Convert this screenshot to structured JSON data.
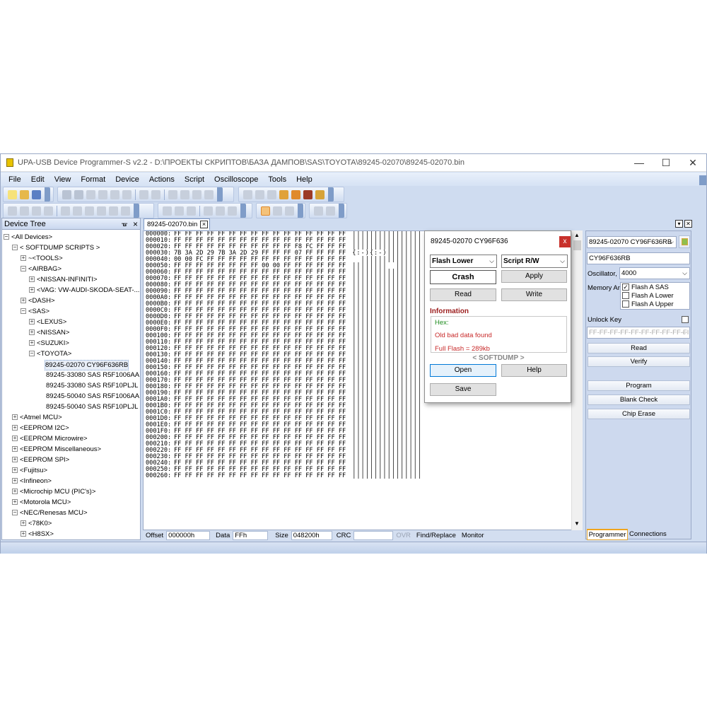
{
  "window": {
    "title": "UPA-USB Device Programmer-S v2.2 - D:\\ПРОЕКТЫ СКРИПТОВ\\БАЗА ДАМПОВ\\SAS\\TOYOTA\\89245-02070\\89245-02070.bin",
    "minimize": "—",
    "maximize": "☐",
    "close": "✕"
  },
  "menu": [
    "File",
    "Edit",
    "View",
    "Format",
    "Device",
    "Actions",
    "Script",
    "Oscilloscope",
    "Tools",
    "Help"
  ],
  "device_tree": {
    "title": "Device Tree",
    "pin": "ᚗ",
    "close": "×",
    "items": [
      {
        "label": "<All Devices>",
        "box": "−"
      },
      {
        "label": "< SOFTDUMP SCRIPTS >",
        "box": "−"
      },
      {
        "label": "~<TOOLS>",
        "box": "+"
      },
      {
        "label": "<AIRBAG>",
        "box": "−"
      },
      {
        "label": "<NISSAN-INFINITI>",
        "box": "+"
      },
      {
        "label": "<VAG: VW-AUDI-SKODA-SEAT-...",
        "box": "+"
      },
      {
        "label": "<DASH>",
        "box": "+"
      },
      {
        "label": "<SAS>",
        "box": "−"
      },
      {
        "label": "<LEXUS>",
        "box": "+"
      },
      {
        "label": "<NISSAN>",
        "box": "+"
      },
      {
        "label": "<SUZUKI>",
        "box": "+"
      },
      {
        "label": "<TOYOTA>",
        "box": "−"
      },
      {
        "label": "89245-02070 CY96F636RB",
        "box": ""
      },
      {
        "label": "89245-33080 SAS R5F1006AA",
        "box": ""
      },
      {
        "label": "89245-33080 SAS R5F10PLJL",
        "box": ""
      },
      {
        "label": "89245-50040 SAS R5F1006AA",
        "box": ""
      },
      {
        "label": "89245-50040 SAS R5F10PLJL",
        "box": ""
      },
      {
        "label": "<Atmel MCU>",
        "box": "+"
      },
      {
        "label": "<EEPROM I2C>",
        "box": "+"
      },
      {
        "label": "<EEPROM Microwire>",
        "box": "+"
      },
      {
        "label": "<EEPROM Miscellaneous>",
        "box": "+"
      },
      {
        "label": "<EEPROM SPI>",
        "box": "+"
      },
      {
        "label": "<Fujitsu>",
        "box": "+"
      },
      {
        "label": "<Infineon>",
        "box": "+"
      },
      {
        "label": "<Microchip MCU (PIC's)>",
        "box": "+"
      },
      {
        "label": "<Motorola MCU>",
        "box": "+"
      },
      {
        "label": "<NEC/Renesas MCU>",
        "box": "−"
      },
      {
        "label": "<78K0>",
        "box": "+"
      },
      {
        "label": "<H8SX>",
        "box": "+"
      }
    ]
  },
  "editor": {
    "tab_label": "89245-02070.bin",
    "tab_close": "×",
    "hex_rows": [
      {
        "addr": "000000:",
        "bytes": "FF FF FF FF FF FF FF FF FF FF FF FF FF FF FF FF",
        "ascii": "||||||||||||||||"
      },
      {
        "addr": "000010:",
        "bytes": "FF FF FF FF FF FF FF FF FF FF FF FF FF FF FF FF",
        "ascii": "||||||||||||||||"
      },
      {
        "addr": "000020:",
        "bytes": "FF FF FF FF FF FF FF FF FF FF FF F8 FC FF FF FF",
        "ascii": "||||||||||||||||"
      },
      {
        "addr": "000030:",
        "bytes": "7B 3A 2D 29 7B 3A 2D 29 FF FF FF 07 FF FF FF FF",
        "ascii": "{:-){:-)||||||||"
      },
      {
        "addr": "000040:",
        "bytes": "00 00 FC FF FF FF FF FF FF FF FF FF FF FF FF FF",
        "ascii": "  ||||||||||||||"
      },
      {
        "addr": "000050:",
        "bytes": "FF FF FF FF FF FF FF FF 00 00 FF FF FF FF FF FF",
        "ascii": "||||||||  ||||||"
      },
      {
        "addr": "000060:",
        "bytes": "FF FF FF FF FF FF FF FF FF FF FF FF FF FF FF FF",
        "ascii": "||||||||||||||||"
      },
      {
        "addr": "000070:",
        "bytes": "FF FF FF FF FF FF FF FF FF FF FF FF FF FF FF FF",
        "ascii": "||||||||||||||||"
      },
      {
        "addr": "000080:",
        "bytes": "FF FF FF FF FF FF FF FF FF FF FF FF FF FF FF FF",
        "ascii": "||||||||||||||||"
      },
      {
        "addr": "000090:",
        "bytes": "FF FF FF FF FF FF FF FF FF FF FF FF FF FF FF FF",
        "ascii": "||||||||||||||||"
      },
      {
        "addr": "0000A0:",
        "bytes": "FF FF FF FF FF FF FF FF FF FF FF FF FF FF FF FF",
        "ascii": "||||||||||||||||"
      },
      {
        "addr": "0000B0:",
        "bytes": "FF FF FF FF FF FF FF FF FF FF FF FF FF FF FF FF",
        "ascii": "||||||||||||||||"
      },
      {
        "addr": "0000C0:",
        "bytes": "FF FF FF FF FF FF FF FF FF FF FF FF FF FF FF FF",
        "ascii": "||||||||||||||||"
      },
      {
        "addr": "0000D0:",
        "bytes": "FF FF FF FF FF FF FF FF FF FF FF FF FF FF FF FF",
        "ascii": "||||||||||||||||"
      },
      {
        "addr": "0000E0:",
        "bytes": "FF FF FF FF FF FF FF FF FF FF FF FF FF FF FF FF",
        "ascii": "||||||||||||||||"
      },
      {
        "addr": "0000F0:",
        "bytes": "FF FF FF FF FF FF FF FF FF FF FF FF FF FF FF FF",
        "ascii": "||||||||||||||||"
      },
      {
        "addr": "000100:",
        "bytes": "FF FF FF FF FF FF FF FF FF FF FF FF FF FF FF FF",
        "ascii": "||||||||||||||||"
      },
      {
        "addr": "000110:",
        "bytes": "FF FF FF FF FF FF FF FF FF FF FF FF FF FF FF FF",
        "ascii": "||||||||||||||||"
      },
      {
        "addr": "000120:",
        "bytes": "FF FF FF FF FF FF FF FF FF FF FF FF FF FF FF FF",
        "ascii": "||||||||||||||||"
      },
      {
        "addr": "000130:",
        "bytes": "FF FF FF FF FF FF FF FF FF FF FF FF FF FF FF FF",
        "ascii": "||||||||||||||||"
      },
      {
        "addr": "000140:",
        "bytes": "FF FF FF FF FF FF FF FF FF FF FF FF FF FF FF FF",
        "ascii": "||||||||||||||||"
      },
      {
        "addr": "000150:",
        "bytes": "FF FF FF FF FF FF FF FF FF FF FF FF FF FF FF FF",
        "ascii": "||||||||||||||||"
      },
      {
        "addr": "000160:",
        "bytes": "FF FF FF FF FF FF FF FF FF FF FF FF FF FF FF FF",
        "ascii": "||||||||||||||||"
      },
      {
        "addr": "000170:",
        "bytes": "FF FF FF FF FF FF FF FF FF FF FF FF FF FF FF FF",
        "ascii": "||||||||||||||||"
      },
      {
        "addr": "000180:",
        "bytes": "FF FF FF FF FF FF FF FF FF FF FF FF FF FF FF FF",
        "ascii": "||||||||||||||||"
      },
      {
        "addr": "000190:",
        "bytes": "FF FF FF FF FF FF FF FF FF FF FF FF FF FF FF FF",
        "ascii": "||||||||||||||||"
      },
      {
        "addr": "0001A0:",
        "bytes": "FF FF FF FF FF FF FF FF FF FF FF FF FF FF FF FF",
        "ascii": "||||||||||||||||"
      },
      {
        "addr": "0001B0:",
        "bytes": "FF FF FF FF FF FF FF FF FF FF FF FF FF FF FF FF",
        "ascii": "||||||||||||||||"
      },
      {
        "addr": "0001C0:",
        "bytes": "FF FF FF FF FF FF FF FF FF FF FF FF FF FF FF FF",
        "ascii": "||||||||||||||||"
      },
      {
        "addr": "0001D0:",
        "bytes": "FF FF FF FF FF FF FF FF FF FF FF FF FF FF FF FF",
        "ascii": "||||||||||||||||"
      },
      {
        "addr": "0001E0:",
        "bytes": "FF FF FF FF FF FF FF FF FF FF FF FF FF FF FF FF",
        "ascii": "||||||||||||||||"
      },
      {
        "addr": "0001F0:",
        "bytes": "FF FF FF FF FF FF FF FF FF FF FF FF FF FF FF FF",
        "ascii": "||||||||||||||||"
      },
      {
        "addr": "000200:",
        "bytes": "FF FF FF FF FF FF FF FF FF FF FF FF FF FF FF FF",
        "ascii": "||||||||||||||||"
      },
      {
        "addr": "000210:",
        "bytes": "FF FF FF FF FF FF FF FF FF FF FF FF FF FF FF FF",
        "ascii": "||||||||||||||||"
      },
      {
        "addr": "000220:",
        "bytes": "FF FF FF FF FF FF FF FF FF FF FF FF FF FF FF FF",
        "ascii": "||||||||||||||||"
      },
      {
        "addr": "000230:",
        "bytes": "FF FF FF FF FF FF FF FF FF FF FF FF FF FF FF FF",
        "ascii": "||||||||||||||||"
      },
      {
        "addr": "000240:",
        "bytes": "FF FF FF FF FF FF FF FF FF FF FF FF FF FF FF FF",
        "ascii": "||||||||||||||||"
      },
      {
        "addr": "000250:",
        "bytes": "FF FF FF FF FF FF FF FF FF FF FF FF FF FF FF FF",
        "ascii": "||||||||||||||||"
      },
      {
        "addr": "000260:",
        "bytes": "FF FF FF FF FF FF FF FF FF FF FF FF FF FF FF FF",
        "ascii": "||||||||||||||||"
      }
    ]
  },
  "statusbar": {
    "offset_label": "Offset",
    "offset_value": "000000h",
    "data_label": "Data",
    "data_value": "FFh",
    "size_label": "Size",
    "size_value": "048200h",
    "crc_label": "CRC",
    "crc_value": "",
    "ovr_label": "OVR",
    "find_replace": "Find/Replace",
    "monitor": "Monitor"
  },
  "dialog": {
    "title": "89245-02070 CY96F636",
    "close": "x",
    "mode_select": "Flash Lower",
    "script_select": "Script R/W",
    "crash_button": "Crash",
    "apply_button": "Apply",
    "read_button": "Read",
    "write_button": "Write",
    "info_title": "Information",
    "info_hex": "Hex:",
    "info_old": "Old bad data found",
    "info_full": "Full Flash = 289kb",
    "brand": "< SOFTDUMP >",
    "open_button": "Open",
    "help_button": "Help",
    "save_button": "Save"
  },
  "programmer_panel": {
    "device_select": "89245-02070 CY96F636RB",
    "device_name": "CY96F636RB",
    "oscillator_label": "Oscillator, k",
    "oscillator_value": "4000",
    "memory_label": "Memory Are",
    "memory_areas": [
      {
        "label": "Flash A SAS",
        "checked": true,
        "mark": "✓"
      },
      {
        "label": "Flash A Lower",
        "checked": false,
        "mark": ""
      },
      {
        "label": "Flash A Upper",
        "checked": false,
        "mark": ""
      }
    ],
    "unlock_key_label": "Unlock Key",
    "unlock_key_value": "FF-FF-FF-FF-FF-FF-FF-FF-FF-FI",
    "read_button": "Read",
    "verify_button": "Verify",
    "program_button": "Program",
    "blank_check_button": "Blank Check",
    "chip_erase_button": "Chip Erase",
    "tab_programmer": "Programmer",
    "tab_connections": "Connections"
  },
  "colors": {
    "accent": "#f0a51e",
    "window_bg": "#cfdcf0",
    "dialog_close": "#c8312b",
    "info_red": "#c82a2a",
    "info_green": "#1e8c1e"
  }
}
